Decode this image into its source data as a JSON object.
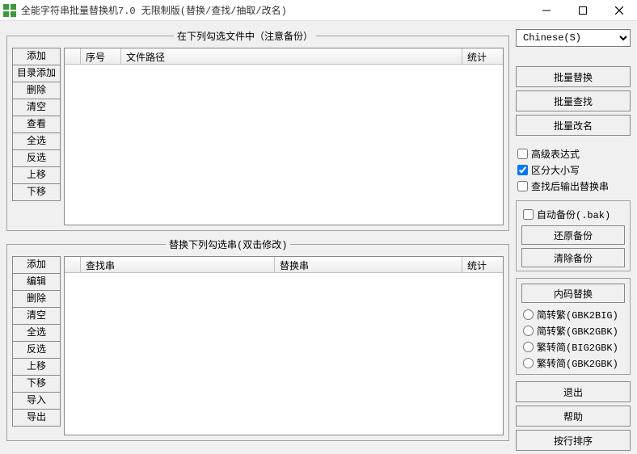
{
  "window": {
    "title": "全能字符串批量替换机7.0 无限制版(替换/查找/抽取/改名)"
  },
  "group1": {
    "legend": "在下列勾选文件中（注意备份）",
    "buttons": {
      "add": "添加",
      "dir_add": "目录添加",
      "delete": "删除",
      "clear": "清空",
      "view": "查看",
      "select_all": "全选",
      "invert": "反选",
      "move_up": "上移",
      "move_down": "下移"
    },
    "columns": {
      "index": "序号",
      "path": "文件路径",
      "stat": "统计"
    }
  },
  "group2": {
    "legend": "替换下列勾选串(双击修改)",
    "buttons": {
      "add": "添加",
      "edit": "编辑",
      "delete": "删除",
      "clear": "清空",
      "select_all": "全选",
      "invert": "反选",
      "move_up": "上移",
      "move_down": "下移",
      "import": "导入",
      "export": "导出"
    },
    "columns": {
      "find": "查找串",
      "replace": "替换串",
      "stat": "统计"
    }
  },
  "sidebar": {
    "lang_selected": "Chinese(S)",
    "batch_replace": "批量替换",
    "batch_find": "批量查找",
    "batch_rename": "批量改名",
    "chk_regex": "高级表达式",
    "chk_case": "区分大小写",
    "chk_output_after_find": "查找后输出替换串",
    "chk_auto_backup": "自动备份(.bak)",
    "restore_backup": "还原备份",
    "clear_backup": "清除备份",
    "code_replace": "内码替换",
    "rad_s2t_gbk2big": "简转繁(GBK2BIG)",
    "rad_s2t_gbk2gbk": "简转繁(GBK2GBK)",
    "rad_t2s_big2gbk": "繁转简(BIG2GBK)",
    "rad_t2s_gbk2gbk": "繁转简(GBK2GBK)",
    "exit": "退出",
    "help": "帮助",
    "sort_by_line": "按行排序"
  },
  "state": {
    "chk_regex": false,
    "chk_case": true,
    "chk_output_after_find": false,
    "chk_auto_backup": false
  }
}
